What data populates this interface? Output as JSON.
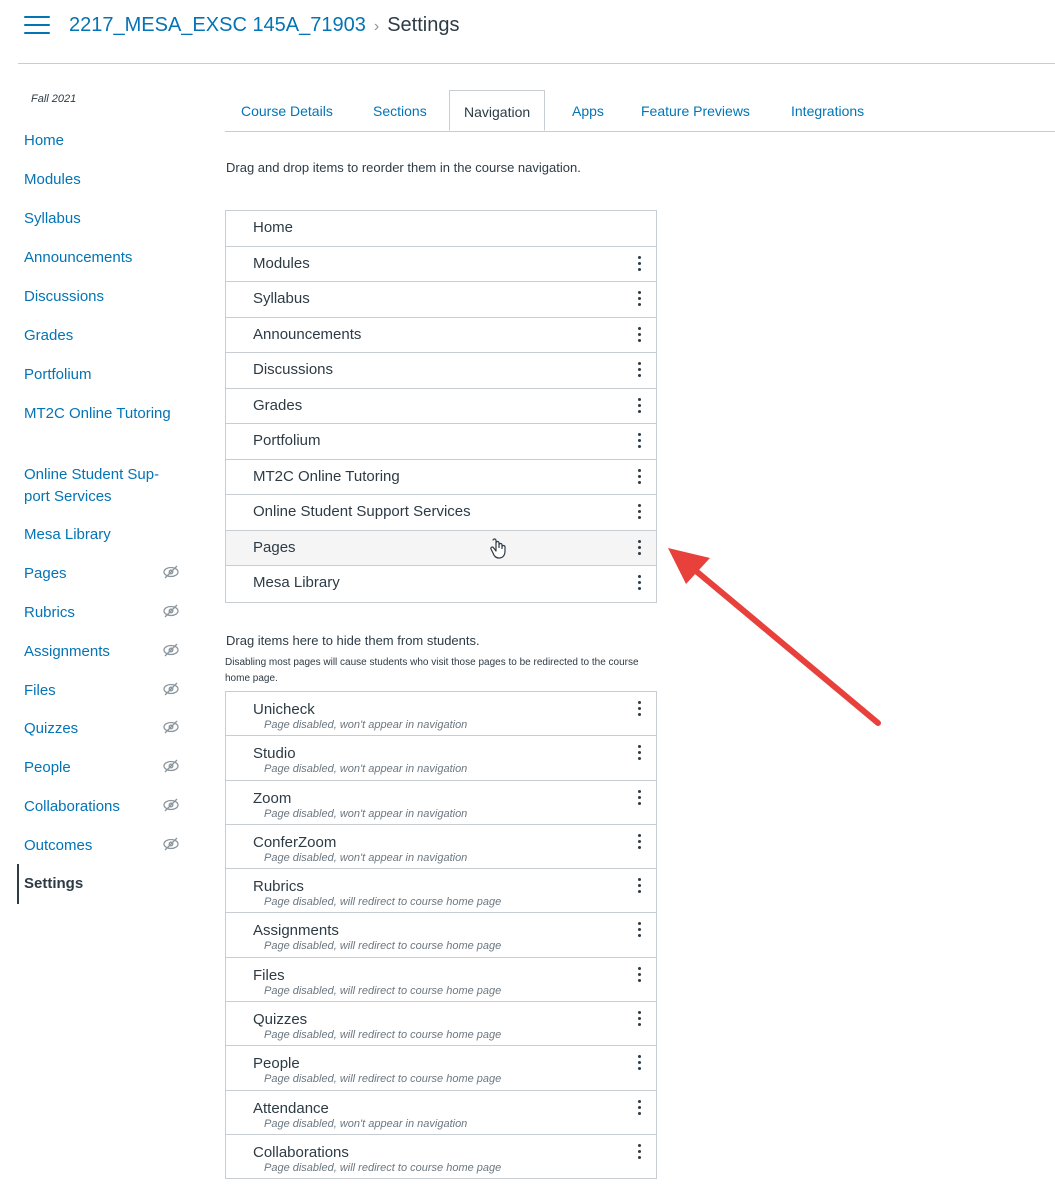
{
  "header": {
    "course": "2217_MESA_EXSC 145A_71903",
    "separator": "›",
    "current": "Settings"
  },
  "sidebar": {
    "term": "Fall 2021",
    "items": [
      {
        "label": "Home",
        "hidden": false
      },
      {
        "label": "Modules",
        "hidden": false
      },
      {
        "label": "Syllabus",
        "hidden": false
      },
      {
        "label": "Announcements",
        "hidden": false
      },
      {
        "label": "Discussions",
        "hidden": false
      },
      {
        "label": "Grades",
        "hidden": false
      },
      {
        "label": "Portfolium",
        "hidden": false
      },
      {
        "label": "MT2C Online Tutoring",
        "hidden": false
      },
      {
        "label": "Online Student Sup- port Services",
        "hidden": false
      },
      {
        "label": "Mesa Library",
        "hidden": false
      },
      {
        "label": "Pages",
        "hidden": true
      },
      {
        "label": "Rubrics",
        "hidden": true
      },
      {
        "label": "Assignments",
        "hidden": true
      },
      {
        "label": "Files",
        "hidden": true
      },
      {
        "label": "Quizzes",
        "hidden": true
      },
      {
        "label": "People",
        "hidden": true
      },
      {
        "label": "Collaborations",
        "hidden": true
      },
      {
        "label": "Outcomes",
        "hidden": true
      },
      {
        "label": "Settings",
        "hidden": false,
        "active": true
      }
    ]
  },
  "tabs": [
    "Course Details",
    "Sections",
    "Navigation",
    "Apps",
    "Feature Previews",
    "Integrations"
  ],
  "active_tab": "Navigation",
  "instructions": "Drag and drop items to reorder them in the course navigation.",
  "enabled_items": [
    "Home",
    "Modules",
    "Syllabus",
    "Announcements",
    "Discussions",
    "Grades",
    "Portfolium",
    "MT2C Online Tutoring",
    "Online Student Support Services",
    "Pages",
    "Mesa Library"
  ],
  "hidden_section": {
    "title": "Drag items here to hide them from students.",
    "note": "Disabling most pages will cause students who visit those pages to be redirected to the course home page."
  },
  "disabled_items": [
    {
      "label": "Unicheck",
      "status": "Page disabled, won't appear in navigation"
    },
    {
      "label": "Studio",
      "status": "Page disabled, won't appear in navigation"
    },
    {
      "label": "Zoom",
      "status": "Page disabled, won't appear in navigation"
    },
    {
      "label": "ConferZoom",
      "status": "Page disabled, won't appear in navigation"
    },
    {
      "label": "Rubrics",
      "status": "Page disabled, will redirect to course home page"
    },
    {
      "label": "Assignments",
      "status": "Page disabled, will redirect to course home page"
    },
    {
      "label": "Files",
      "status": "Page disabled, will redirect to course home page"
    },
    {
      "label": "Quizzes",
      "status": "Page disabled, will redirect to course home page"
    },
    {
      "label": "People",
      "status": "Page disabled, will redirect to course home page"
    },
    {
      "label": "Attendance",
      "status": "Page disabled, won't appear in navigation"
    },
    {
      "label": "Collaborations",
      "status": "Page disabled, will redirect to course home page"
    }
  ],
  "colors": {
    "link": "#0374b5",
    "text": "#2d3b45",
    "border": "#c7cdd1",
    "arrow": "#e8403b"
  }
}
